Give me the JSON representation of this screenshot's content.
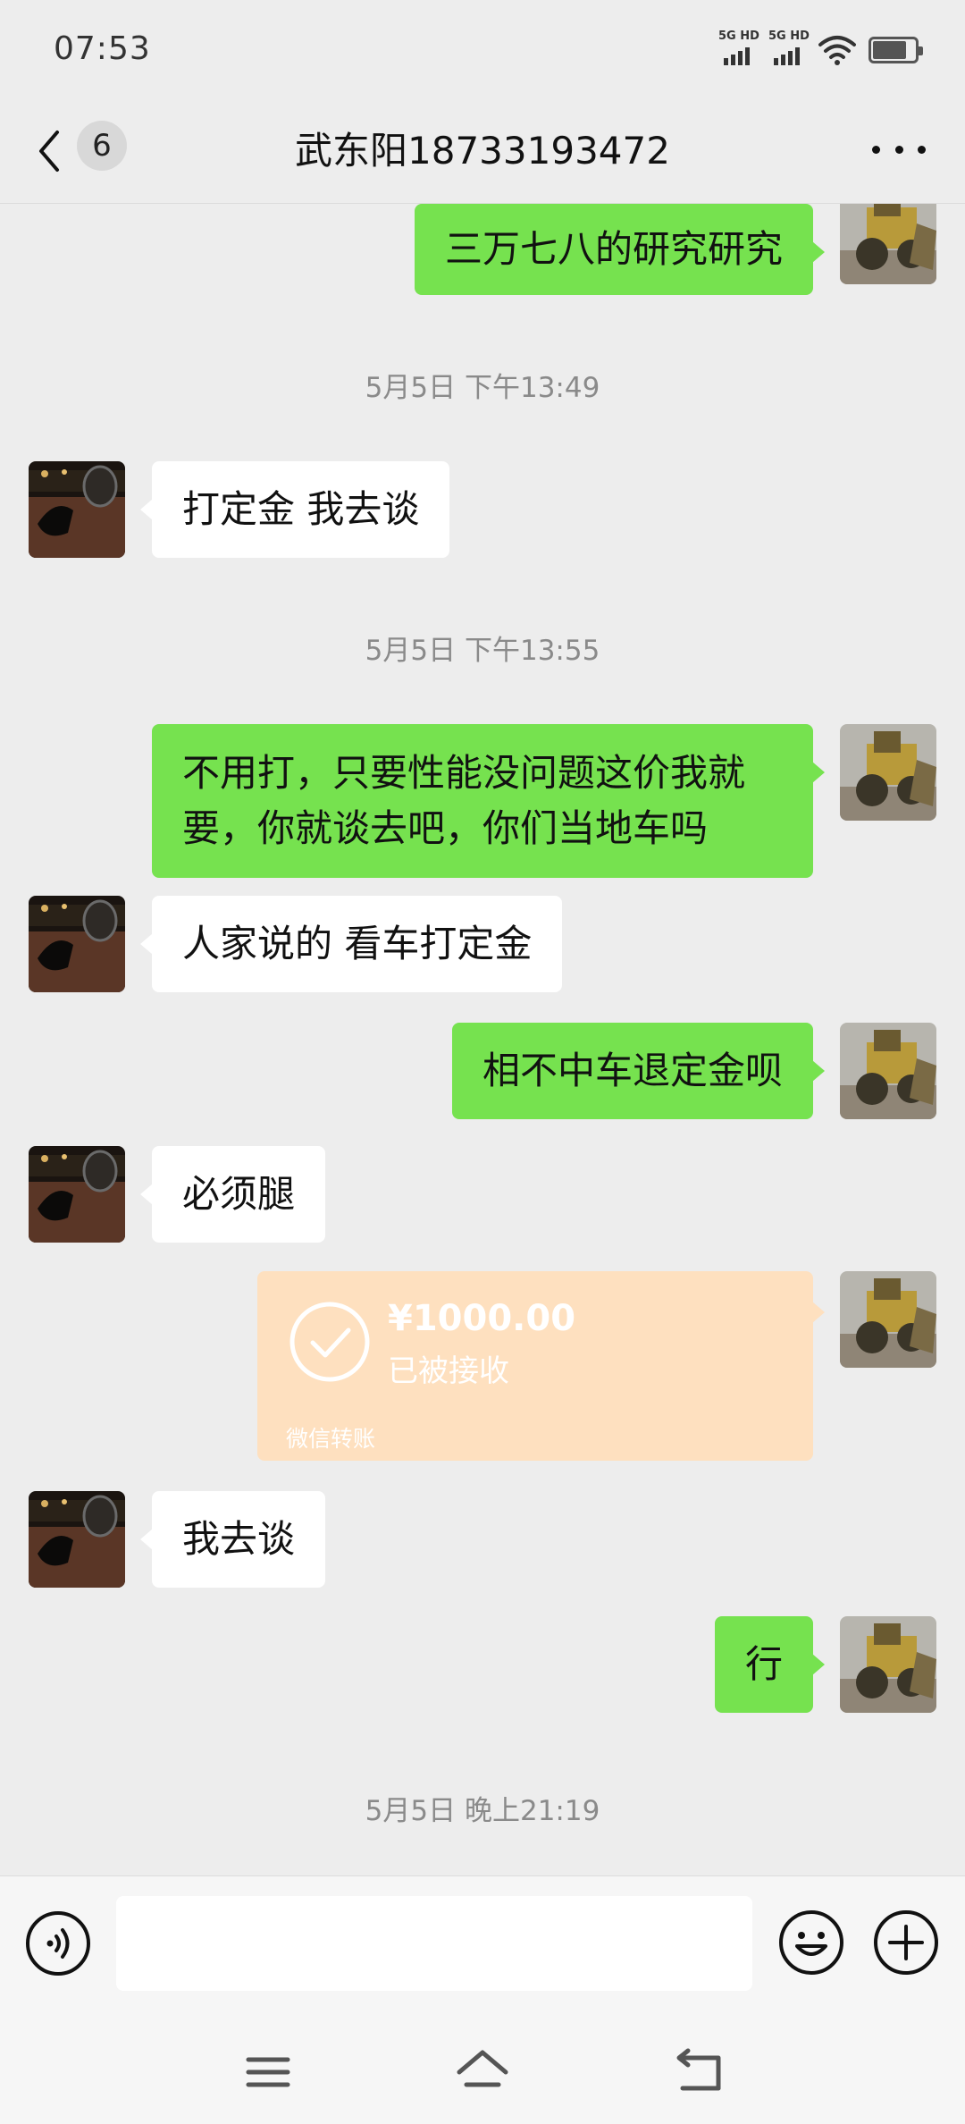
{
  "status_bar": {
    "time": "07:53",
    "sim1_label": "5G HD",
    "sim2_label": "5G HD",
    "battery_level": 0.8
  },
  "header": {
    "unread_count": "6",
    "title": "武东阳18733193472"
  },
  "messages": [
    {
      "type": "text",
      "side": "right",
      "text": "三万七八的研究研究"
    },
    {
      "type": "time",
      "text": "5月5日 下午13:49"
    },
    {
      "type": "text",
      "side": "left",
      "text": "打定金 我去谈"
    },
    {
      "type": "time",
      "text": "5月5日 下午13:55"
    },
    {
      "type": "text",
      "side": "right",
      "text": "不用打，只要性能没问题这价我就要，你就谈去吧，你们当地车吗"
    },
    {
      "type": "text",
      "side": "left",
      "text": "人家说的 看车打定金"
    },
    {
      "type": "text",
      "side": "right",
      "text": "相不中车退定金呗"
    },
    {
      "type": "text",
      "side": "left",
      "text": "必须腿"
    },
    {
      "type": "transfer",
      "side": "right",
      "amount": "¥1000.00",
      "status": "已被接收",
      "source": "微信转账"
    },
    {
      "type": "text",
      "side": "left",
      "text": "我去谈"
    },
    {
      "type": "text",
      "side": "right",
      "text": "行"
    },
    {
      "type": "time",
      "text": "5月5日 晚上21:19"
    }
  ],
  "input": {
    "placeholder": "",
    "value": ""
  },
  "icons": {
    "back": "chevron-left-icon",
    "more": "more-dots-icon",
    "voice": "voice-icon",
    "emoji": "emoji-icon",
    "plus": "plus-icon",
    "menu": "menu-icon",
    "home": "home-icon",
    "return": "back-nav-icon"
  },
  "colors": {
    "background": "#ededed",
    "bubble_self": "#76e24f",
    "bubble_other": "#ffffff",
    "transfer_received": "#fee0bf"
  }
}
